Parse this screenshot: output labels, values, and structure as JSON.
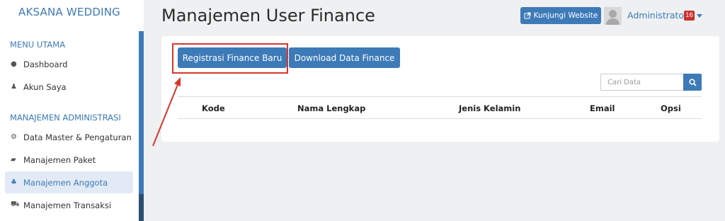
{
  "sidebar": {
    "brand": "AKSANA WEDDING",
    "section_main": "MENU UTAMA",
    "section_admin": "MANAJEMEN ADMINISTRASI",
    "items": [
      {
        "label": "Dashboard",
        "icon": "globe-icon"
      },
      {
        "label": "Akun Saya",
        "icon": "user-icon"
      },
      {
        "label": "Data Master & Pengaturan",
        "icon": "cogs-icon"
      },
      {
        "label": "Manajemen Paket",
        "icon": "book-icon"
      },
      {
        "label": "Manajemen Anggota",
        "icon": "users-icon",
        "active": true
      },
      {
        "label": "Manajemen Transaksi",
        "icon": "cart-icon"
      }
    ]
  },
  "header": {
    "title": "Manajemen User Finance",
    "visit_website": "Kunjungi Website",
    "user_name": "Administrator",
    "notification_count": "16"
  },
  "toolbar": {
    "register_label": "Registrasi Finance Baru",
    "download_label": "Download Data Finance"
  },
  "search": {
    "placeholder": "Cari Data"
  },
  "table": {
    "columns": [
      "Kode",
      "Nama Lengkap",
      "Jenis Kelamin",
      "Email",
      "Opsi"
    ]
  },
  "colors": {
    "primary": "#3d7ab8",
    "highlight": "#d9342b",
    "badge": "#c9302c"
  }
}
